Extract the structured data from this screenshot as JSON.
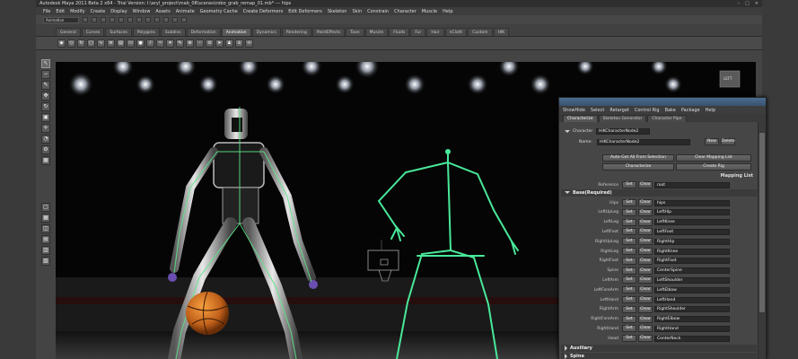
{
  "window": {
    "title": "Autodesk Maya 2011 Beta 2 x64 - Trial Version: I:\\aryl_project\\mab_08\\scenes\\robo_grab_remap_01.mb* --- hips",
    "controls": [
      "–",
      "□",
      "✕"
    ]
  },
  "menubar": [
    "File",
    "Edit",
    "Modify",
    "Create",
    "Display",
    "Window",
    "Assets",
    "Animate",
    "Geometry Cache",
    "Create Deformers",
    "Edit Deformers",
    "Skeleton",
    "Skin",
    "Constrain",
    "Character",
    "Muscle",
    "Help"
  ],
  "statusline": {
    "mode": "Animation"
  },
  "shelf_tabs": [
    "General",
    "Curves",
    "Surfaces",
    "Polygons",
    "Subdivs",
    "Deformation",
    "Animation",
    "Dynamics",
    "Rendering",
    "PaintEffects",
    "Toon",
    "Muscle",
    "Fluids",
    "Fur",
    "Hair",
    "nCloth",
    "Custom",
    "HIK"
  ],
  "active_shelf_tab": "Animation",
  "viewport": {
    "cube_label": "LEFT"
  },
  "character_controls": {
    "menu": [
      "ShowHide",
      "Select",
      "Retarget",
      "Control Rig",
      "Bake",
      "Package",
      "Help"
    ],
    "tabs": [
      "Characterize",
      "Skeleton Generator",
      "Character Pipe"
    ],
    "character_label": "Character",
    "character_value": "HIKCharacterNode2",
    "name_label": "Name:",
    "name_value": "HIKCharacterNode2",
    "new_btn": "New",
    "delete_btn": "Delete",
    "auto_get_btn": "Auto-Get All From Selection",
    "clear_mapping_btn": "Clear Mapping List",
    "characterize_btn": "Characterize",
    "create_rig_btn": "Create Rig",
    "mapping_list_title": "Mapping List",
    "reference_label": "Reference",
    "set_label": "Set",
    "clear_label": "Clear",
    "reference_value": "root",
    "sections": {
      "base": "Base(Required)",
      "auxiliary": "Auxiliary",
      "spine": "Spine"
    },
    "mappings": [
      {
        "label": "Hips",
        "value": "hips"
      },
      {
        "label": "LeftUpLeg",
        "value": "LeftHip"
      },
      {
        "label": "LeftLeg",
        "value": "LeftKnee"
      },
      {
        "label": "LeftFoot",
        "value": "LeftFoot"
      },
      {
        "label": "RightUpLeg",
        "value": "RightHip"
      },
      {
        "label": "RightLeg",
        "value": "RightKnee"
      },
      {
        "label": "RightFoot",
        "value": "RightFoot"
      },
      {
        "label": "Spine",
        "value": "CenterSpine"
      },
      {
        "label": "LeftArm",
        "value": "LeftShoulder"
      },
      {
        "label": "LeftForeArm",
        "value": "LeftElbow"
      },
      {
        "label": "LeftHand",
        "value": "LeftHand"
      },
      {
        "label": "RightArm",
        "value": "RightShoulder"
      },
      {
        "label": "RightForeArm",
        "value": "RightElbow"
      },
      {
        "label": "RightHand",
        "value": "RightHand"
      },
      {
        "label": "Head",
        "value": "CenterNeck"
      }
    ]
  }
}
